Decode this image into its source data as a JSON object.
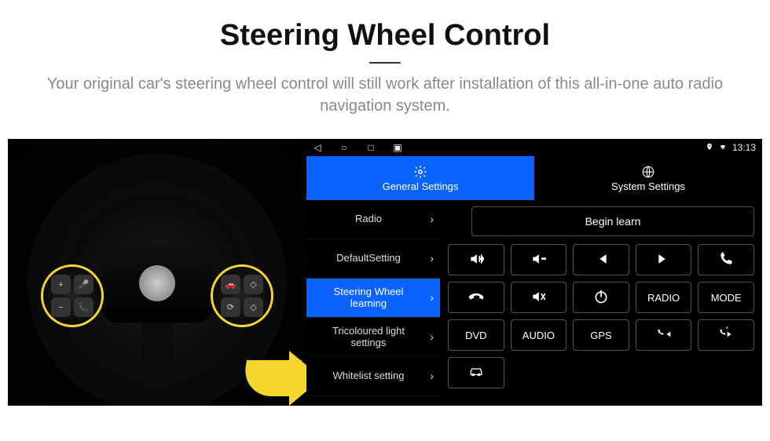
{
  "header": {
    "title": "Steering Wheel Control",
    "subtitle": "Your original car's steering wheel control will still work after installation of this all-in-one auto radio navigation system."
  },
  "wheel": {
    "left_buttons": [
      "+",
      "voice",
      "−",
      "phone"
    ],
    "right_buttons": [
      "car",
      "diamond",
      "rotate",
      "diamond"
    ]
  },
  "statusbar": {
    "icons": [
      "back",
      "home",
      "recent",
      "screenshot"
    ],
    "right_icons": [
      "location",
      "wifi"
    ],
    "time": "13:13"
  },
  "tabs": [
    {
      "label": "General Settings",
      "icon": "gear",
      "active": true
    },
    {
      "label": "System Settings",
      "icon": "globe",
      "active": false
    }
  ],
  "menu": [
    {
      "label": "Radio",
      "active": false
    },
    {
      "label": "DefaultSetting",
      "active": false
    },
    {
      "label": "Steering Wheel learning",
      "active": true
    },
    {
      "label": "Tricoloured light settings",
      "active": false
    },
    {
      "label": "Whitelist setting",
      "active": false
    }
  ],
  "main": {
    "begin_label": "Begin learn",
    "buttons": [
      {
        "name": "vol-up",
        "icon": "vol-up",
        "text": ""
      },
      {
        "name": "vol-down",
        "icon": "vol-down",
        "text": ""
      },
      {
        "name": "prev-track",
        "icon": "prev",
        "text": ""
      },
      {
        "name": "next-track",
        "icon": "next",
        "text": ""
      },
      {
        "name": "call",
        "icon": "phone",
        "text": ""
      },
      {
        "name": "hangup",
        "icon": "hangup",
        "text": ""
      },
      {
        "name": "mute",
        "icon": "mute",
        "text": ""
      },
      {
        "name": "power",
        "icon": "power",
        "text": ""
      },
      {
        "name": "radio",
        "icon": "",
        "text": "RADIO"
      },
      {
        "name": "mode",
        "icon": "",
        "text": "MODE"
      },
      {
        "name": "dvd",
        "icon": "",
        "text": "DVD"
      },
      {
        "name": "audio",
        "icon": "",
        "text": "AUDIO"
      },
      {
        "name": "gps",
        "icon": "",
        "text": "GPS"
      },
      {
        "name": "call-prev",
        "icon": "phone-prev",
        "text": ""
      },
      {
        "name": "call-next",
        "icon": "phone-next",
        "text": ""
      }
    ],
    "car_button": {
      "name": "car",
      "icon": "car"
    }
  }
}
